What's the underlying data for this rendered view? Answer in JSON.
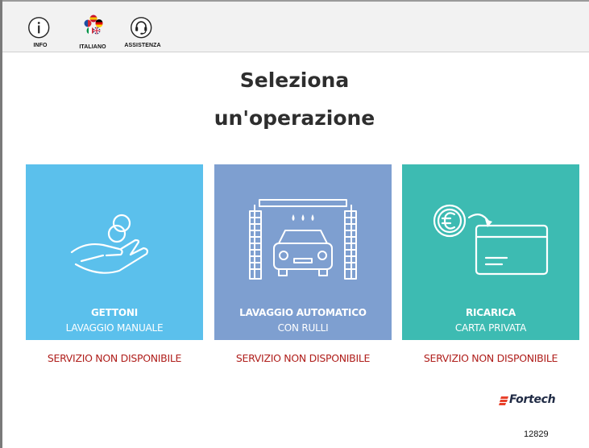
{
  "toolbar": {
    "info_label": "INFO",
    "language_label": "ITALIANO",
    "support_label": "ASSISTENZA"
  },
  "heading": {
    "line1": "Seleziona",
    "line2": "un'operazione"
  },
  "cards": [
    {
      "title": "GETTONI",
      "subtitle": "LAVAGGIO MANUALE",
      "status": "SERVIZIO NON DISPONIBILE",
      "color": "#5bc0ec",
      "icon": "hand-coins-icon"
    },
    {
      "title": "LAVAGGIO AUTOMATICO",
      "subtitle": "CON RULLI",
      "status": "SERVIZIO NON DISPONIBILE",
      "color": "#7e9fd0",
      "icon": "car-wash-icon"
    },
    {
      "title": "RICARICA",
      "subtitle": "CARTA PRIVATA",
      "status": "SERVIZIO NON DISPONIBILE",
      "color": "#3dbbb2",
      "icon": "euro-card-icon"
    }
  ],
  "footer": {
    "brand": "Fortech",
    "serial": "12829"
  },
  "colors": {
    "status_red": "#b0201d",
    "toolbar_bg": "#f2f2f2"
  }
}
